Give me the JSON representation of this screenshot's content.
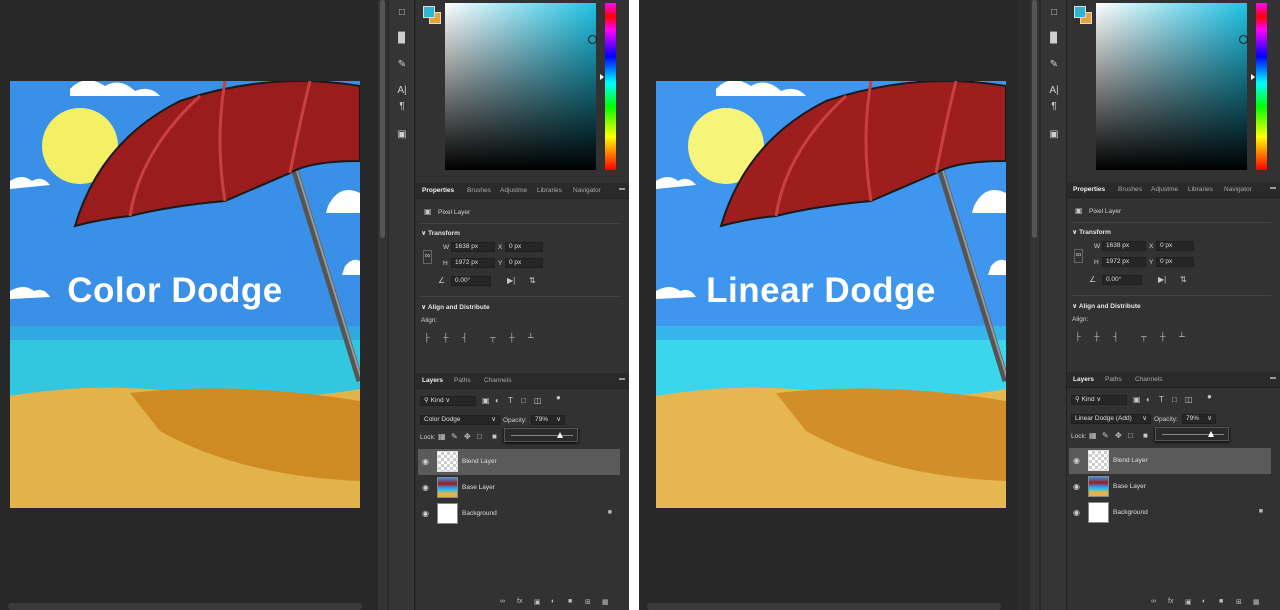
{
  "colors": {
    "foreground": "#2fb5cf",
    "background": "#e8a23c",
    "sky": "#3a90e6",
    "umbrella": "#9b1c1c",
    "sea": "#33c6e0",
    "sand": "#e2b34b",
    "sun": "#f4f066"
  },
  "toolstrip": {
    "icons": [
      "comment-icon",
      "histogram-icon",
      "brush-settings-icon",
      "character-icon",
      "paragraph-icon",
      "3d-cube-icon"
    ]
  },
  "panes": [
    {
      "artwork_title": "Color Dodge",
      "properties_tabs": [
        "Properties",
        "Brushes",
        "Adjustme",
        "Libraries",
        "Navigator"
      ],
      "layer_type": "Pixel Layer",
      "transform_label": "Transform",
      "w_label": "W",
      "w_value": "1638 px",
      "h_label": "H",
      "h_value": "1972 px",
      "x_label": "X",
      "x_value": "0 px",
      "y_label": "Y",
      "y_value": "0 px",
      "angle_value": "0.00°",
      "align_title": "Align and Distribute",
      "align_label": "Align:",
      "layers_tabs": [
        "Layers",
        "Paths",
        "Channels"
      ],
      "filter_kind": "Kind",
      "blend_mode": "Color Dodge",
      "opacity_label": "Opacity:",
      "opacity_value": "79%",
      "opacity": 0.79,
      "lock_label": "Lock:",
      "layers": [
        {
          "name": "Blend Layer",
          "thumb": "transparent",
          "selected": true,
          "locked": false
        },
        {
          "name": "Base Layer",
          "thumb": "image",
          "selected": false,
          "locked": false
        },
        {
          "name": "Background",
          "thumb": "white",
          "selected": false,
          "locked": true
        }
      ]
    },
    {
      "artwork_title": "Linear Dodge",
      "properties_tabs": [
        "Properties",
        "Brushes",
        "Adjustme",
        "Libraries",
        "Navigator"
      ],
      "layer_type": "Pixel Layer",
      "transform_label": "Transform",
      "w_label": "W",
      "w_value": "1638 px",
      "h_label": "H",
      "h_value": "1972 px",
      "x_label": "X",
      "x_value": "0 px",
      "y_label": "Y",
      "y_value": "0 px",
      "angle_value": "0.00°",
      "align_title": "Align and Distribute",
      "align_label": "Align:",
      "layers_tabs": [
        "Layers",
        "Paths",
        "Channels"
      ],
      "filter_kind": "Kind",
      "blend_mode": "Linear Dodge (Add)",
      "opacity_label": "Opacity:",
      "opacity_value": "79%",
      "opacity": 0.79,
      "lock_label": "Lock:",
      "layers": [
        {
          "name": "Blend Layer",
          "thumb": "transparent",
          "selected": true,
          "locked": false
        },
        {
          "name": "Base Layer",
          "thumb": "image",
          "selected": false,
          "locked": false
        },
        {
          "name": "Background",
          "thumb": "white",
          "selected": false,
          "locked": true
        }
      ]
    }
  ]
}
